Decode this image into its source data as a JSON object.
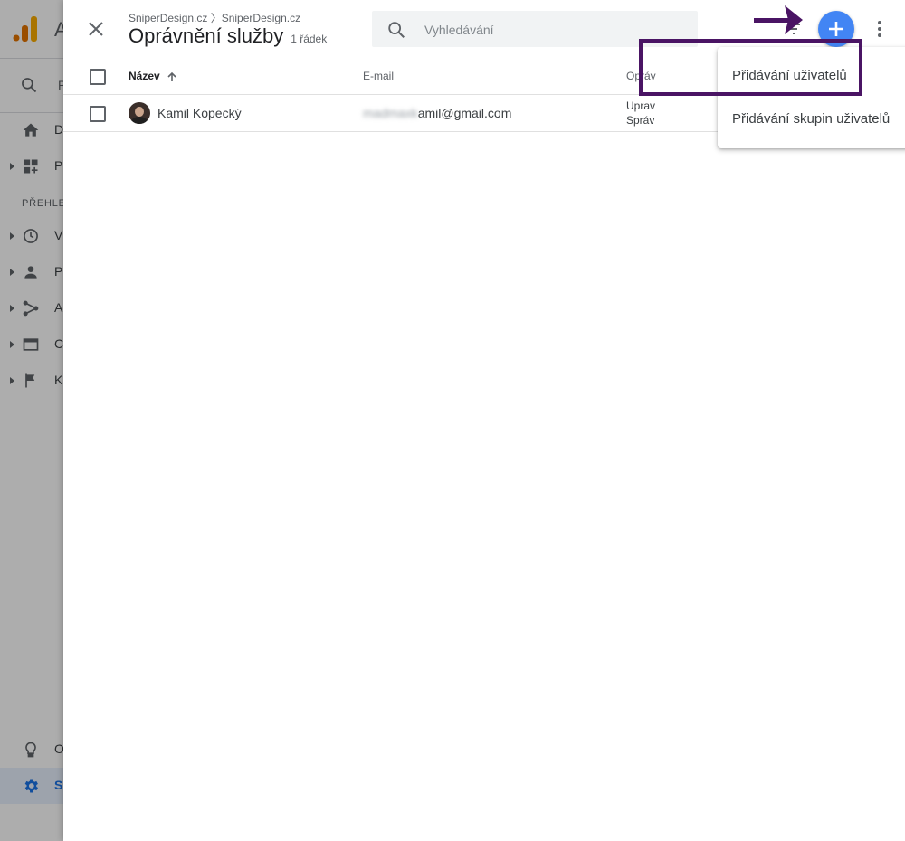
{
  "panel": {
    "breadcrumb": "SniperDesign.cz 〉SniperDesign.cz",
    "title": "Oprávnění služby",
    "row_count": "1 řádek"
  },
  "search": {
    "placeholder": "Vyhledávání"
  },
  "table": {
    "columns": {
      "name": "Název",
      "email": "E-mail",
      "permissions": "Opráv"
    },
    "rows": [
      {
        "name": "Kamil Kopecký",
        "email_blurred": "madmaxk",
        "email_visible": "amil@gmail.com",
        "perm_line1": "Uprav",
        "perm_line2": "Správ"
      }
    ]
  },
  "menu": {
    "items": [
      "Přidávání uživatelů",
      "Přidávání skupin uživatelů"
    ]
  },
  "background_sidebar": {
    "section_label": "PŘEHLE",
    "items": [
      "D",
      "P",
      "V",
      "P",
      "A",
      "C",
      "K",
      "O",
      "Sp"
    ]
  },
  "colors": {
    "accent": "#4285f4",
    "highlight_border": "#4a1464",
    "brand_orange": "#f9ab00"
  }
}
